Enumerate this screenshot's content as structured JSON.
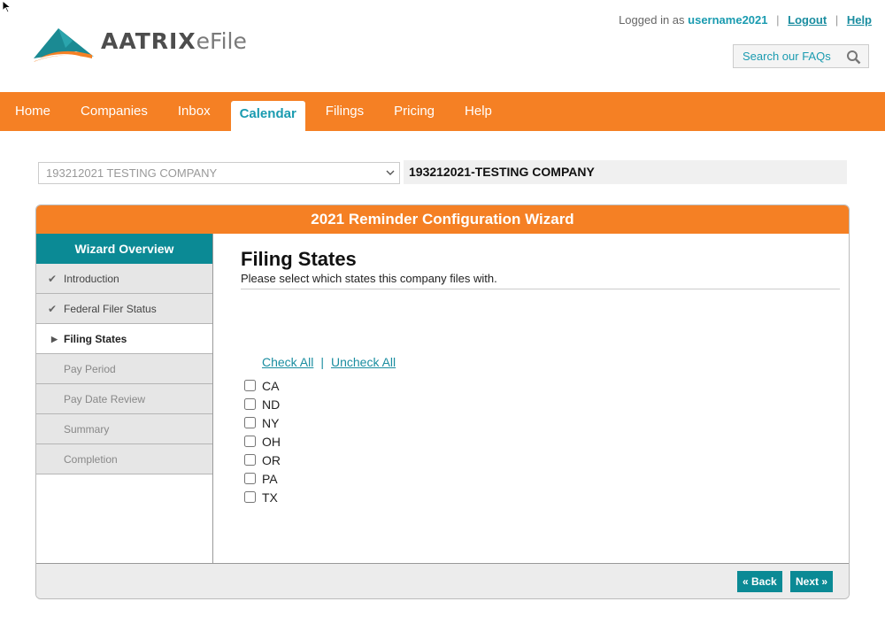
{
  "header": {
    "logo_brand": "AATRIX",
    "logo_product": "eFile",
    "logged_in_text": "Logged in as",
    "username": "username2021",
    "logout_label": "Logout",
    "help_label": "Help",
    "search_placeholder": "Search our FAQs"
  },
  "nav": {
    "items": [
      "Home",
      "Companies",
      "Inbox",
      "Calendar",
      "Filings",
      "Pricing",
      "Help"
    ],
    "active": "Calendar"
  },
  "company": {
    "select_value": "193212021 TESTING COMPANY",
    "label": "193212021-TESTING COMPANY"
  },
  "wizard": {
    "title": "2021 Reminder Configuration Wizard",
    "overview_label": "Wizard Overview",
    "steps": [
      {
        "label": "Introduction",
        "status": "done"
      },
      {
        "label": "Federal Filer Status",
        "status": "done"
      },
      {
        "label": "Filing States",
        "status": "current"
      },
      {
        "label": "Pay Period",
        "status": "pending"
      },
      {
        "label": "Pay Date Review",
        "status": "pending"
      },
      {
        "label": "Summary",
        "status": "pending"
      },
      {
        "label": "Completion",
        "status": "pending"
      }
    ],
    "content": {
      "heading": "Filing States",
      "subtitle": "Please select which states this company files with.",
      "check_all": "Check All",
      "uncheck_all": "Uncheck All",
      "separator": "|",
      "states": [
        "CA",
        "ND",
        "NY",
        "OH",
        "OR",
        "PA",
        "TX"
      ]
    },
    "back_label": "« Back",
    "next_label": "Next »"
  },
  "colors": {
    "brand_orange": "#f58024",
    "brand_teal": "#0b8a95",
    "link_teal": "#1a8da0"
  }
}
